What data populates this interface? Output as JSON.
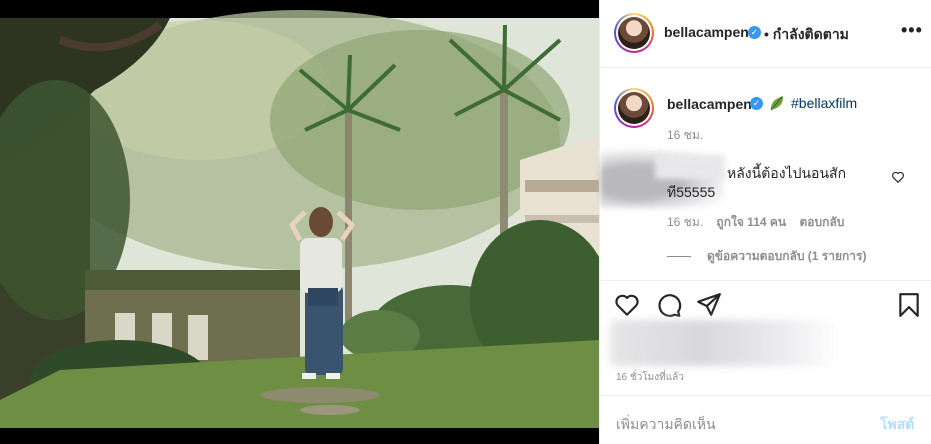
{
  "post": {
    "username": "bellacampen",
    "follow_status": "• กำลังติดตาม",
    "caption_hashtag": "#bellaxfilm",
    "caption_time": "16 ชม.",
    "more_icon": "more-horizontal-icon",
    "verified_icon": "verified-badge-icon"
  },
  "comment": {
    "text_line1": "หลังนี้ต้องไปนอนสัก",
    "text_line2": "ที55555",
    "time": "16 ชม.",
    "likes": "ถูกใจ 114 คน",
    "reply": "ตอบกลับ",
    "view_replies": "ดูข้อความตอบกลับ (1 รายการ)"
  },
  "footer": {
    "posted_time": "16 ชั่วโมงที่แล้ว",
    "add_comment_placeholder": "เพิ่มความคิดเห็น",
    "post_button": "โพสต์"
  },
  "colors": {
    "link": "#00376b",
    "verified": "#3897f0",
    "secondary_text": "#8e8e8e",
    "post_disabled": "#b2dffc"
  }
}
